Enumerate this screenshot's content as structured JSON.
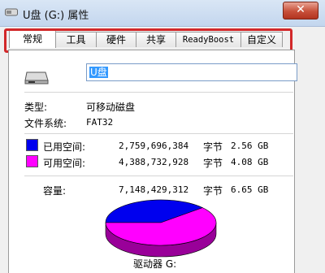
{
  "window": {
    "title": "U盘 (G:) 属性",
    "close_label": "✕"
  },
  "tabs": [
    "常规",
    "工具",
    "硬件",
    "共享",
    "ReadyBoost",
    "自定义"
  ],
  "general": {
    "volume_name": "U盘",
    "type_label": "类型:",
    "type_value": "可移动磁盘",
    "fs_label": "文件系统:",
    "fs_value": "FAT32",
    "used": {
      "label": "已用空间:",
      "bytes": "2,759,696,384",
      "unit": "字节",
      "size": "2.56 GB",
      "color": "#0000ee"
    },
    "free": {
      "label": "可用空间:",
      "bytes": "4,388,732,928",
      "unit": "字节",
      "size": "4.08 GB",
      "color": "#ff00ff"
    },
    "capacity": {
      "label": "容量:",
      "bytes": "7,148,429,312",
      "unit": "字节",
      "size": "6.65 GB"
    },
    "drive_label": "驱动器 G:"
  },
  "chart_data": {
    "type": "pie",
    "values": [
      2759696384,
      4388732928
    ],
    "colors": [
      "#0000ee",
      "#ff00ff"
    ]
  }
}
